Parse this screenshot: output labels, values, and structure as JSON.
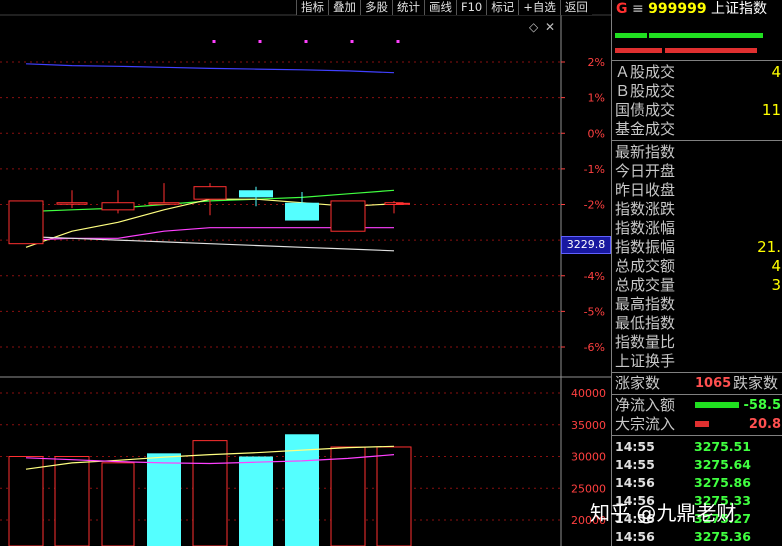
{
  "toolbar": {
    "items": [
      "指标",
      "叠加",
      "多股",
      "统计",
      "画线",
      "F10",
      "标记",
      "+自选",
      "返回"
    ]
  },
  "price_axis": {
    "labels": [
      "2%",
      "1%",
      "0%",
      "-1%",
      "-2%",
      "-3%",
      "-4%",
      "-5%",
      "-6%"
    ],
    "current_price": "3229.8"
  },
  "volume_axis": {
    "labels": [
      "40000",
      "35000",
      "30000",
      "25000",
      "20000"
    ]
  },
  "chart_data": [
    {
      "type": "candlestick",
      "title": "",
      "y_unit": "%",
      "ylim": [
        -6.6,
        2.6
      ],
      "x": [
        1,
        2,
        3,
        4,
        5,
        6,
        7,
        8,
        9
      ],
      "candles": [
        {
          "open": -3.1,
          "high": -1.9,
          "low": -3.1,
          "close": -1.9,
          "dir": "up"
        },
        {
          "open": -1.95,
          "high": -1.6,
          "low": -2.1,
          "close": -1.95,
          "dir": "doji"
        },
        {
          "open": -2.15,
          "high": -1.6,
          "low": -2.25,
          "close": -1.95,
          "dir": "up"
        },
        {
          "open": -1.95,
          "high": -1.4,
          "low": -2.0,
          "close": -1.95,
          "dir": "doji"
        },
        {
          "open": -1.85,
          "high": -1.4,
          "low": -2.3,
          "close": -1.5,
          "dir": "up"
        },
        {
          "open": -1.6,
          "high": -1.5,
          "low": -2.05,
          "close": -1.8,
          "dir": "down"
        },
        {
          "open": -1.95,
          "high": -1.65,
          "low": -2.45,
          "close": -2.45,
          "dir": "down"
        },
        {
          "open": -2.75,
          "high": -1.9,
          "low": -2.75,
          "close": -1.9,
          "dir": "up"
        },
        {
          "open": -2.0,
          "high": -1.9,
          "low": -2.25,
          "close": -1.95,
          "dir": "up"
        }
      ],
      "ma_lines": [
        {
          "color": "#40ff40",
          "values": [
            -2.2,
            -2.15,
            -2.1,
            -2.0,
            -1.9,
            -1.85,
            -1.8,
            -1.7,
            -1.6
          ]
        },
        {
          "color": "#ffff80",
          "values": [
            -3.2,
            -2.75,
            -2.5,
            -2.15,
            -1.85,
            -1.85,
            -1.95,
            -2.05,
            -1.98
          ]
        },
        {
          "color": "#ff40ff",
          "values": [
            -3.0,
            -2.95,
            -2.95,
            -2.75,
            -2.65,
            -2.65,
            -2.65,
            -2.65,
            -2.65
          ]
        },
        {
          "color": "#e0e0e0",
          "values": [
            -2.9,
            -2.95,
            -3.0,
            -3.05,
            -3.1,
            -3.15,
            -3.2,
            -3.25,
            -3.3
          ]
        },
        {
          "color": "#4040ff",
          "values": [
            1.95,
            1.9,
            1.88,
            1.85,
            1.82,
            1.8,
            1.78,
            1.75,
            1.7
          ]
        }
      ],
      "markers": [
        1,
        2,
        3,
        4,
        5
      ]
    },
    {
      "type": "bar",
      "title": "",
      "ylim": [
        17000,
        43000
      ],
      "values": [
        30000,
        30000,
        29000,
        30500,
        32500,
        30000,
        33500,
        31500,
        31500
      ],
      "colors": [
        "up",
        "up",
        "up",
        "down",
        "up",
        "down",
        "down",
        "up",
        "up"
      ],
      "ma_lines": [
        {
          "color": "#ffff80",
          "values": [
            28000,
            29000,
            29400,
            29900,
            30300,
            30600,
            31000,
            31400,
            31600
          ]
        },
        {
          "color": "#ff40ff",
          "values": [
            29800,
            29500,
            29200,
            29000,
            28900,
            29100,
            29300,
            29700,
            30300
          ]
        }
      ]
    }
  ],
  "panel": {
    "title_letter": "G",
    "title_menu": "≡",
    "code": "999999",
    "name": "上证指数",
    "bar_green": "#20e020",
    "bar_red": "#e03030",
    "trade_rows": [
      {
        "label": "Ａ股成交",
        "value": "4"
      },
      {
        "label": "Ｂ股成交",
        "value": ""
      },
      {
        "label": "国债成交",
        "value": "11"
      },
      {
        "label": "基金成交",
        "value": ""
      }
    ],
    "index_rows": [
      {
        "label": "最新指数",
        "value": ""
      },
      {
        "label": "今日开盘",
        "value": ""
      },
      {
        "label": "昨日收盘",
        "value": ""
      },
      {
        "label": "指数涨跌",
        "value": ""
      },
      {
        "label": "指数涨幅",
        "value": ""
      },
      {
        "label": "指数振幅",
        "value": "21."
      },
      {
        "label": "总成交额",
        "value": "4"
      },
      {
        "label": "总成交量",
        "value": "3"
      },
      {
        "label": "最高指数",
        "value": ""
      },
      {
        "label": "最低指数",
        "value": ""
      },
      {
        "label": "指数量比",
        "value": ""
      },
      {
        "label": "上证换手",
        "value": ""
      }
    ],
    "rise_label": "涨家数",
    "rise_value": "1065",
    "fall_label": "跌家数",
    "net_inflow_label": "净流入额",
    "net_inflow_value": "-58.5",
    "block_inflow_label": "大宗流入",
    "block_inflow_value": "20.8",
    "ticks": [
      {
        "time": "14:55",
        "price": "3275.51"
      },
      {
        "time": "14:55",
        "price": "3275.64"
      },
      {
        "time": "14:56",
        "price": "3275.86"
      },
      {
        "time": "14:56",
        "price": "3275.33"
      },
      {
        "time": "14:56",
        "price": "3275.27"
      },
      {
        "time": "14:56",
        "price": "3275.36"
      }
    ]
  },
  "watermark": "知乎 @九鼎老财"
}
